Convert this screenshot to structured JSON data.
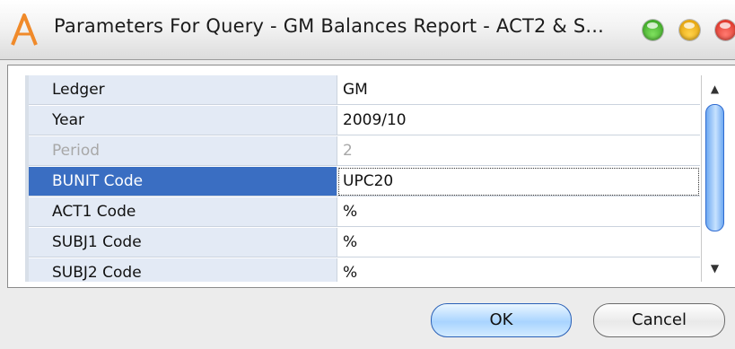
{
  "window": {
    "title": "Parameters For Query - GM Balances Report - ACT2 & S...",
    "controls": [
      "green-zoom",
      "yellow-minimize",
      "red-close"
    ]
  },
  "parameters": {
    "rows": [
      {
        "name": "Ledger",
        "value": "GM",
        "state": "normal"
      },
      {
        "name": "Year",
        "value": "2009/10",
        "state": "normal"
      },
      {
        "name": "Period",
        "value": "2",
        "state": "disabled"
      },
      {
        "name": "BUNIT Code",
        "value": "UPC20",
        "state": "selected"
      },
      {
        "name": "ACT1 Code",
        "value": "%",
        "state": "normal"
      },
      {
        "name": "SUBJ1 Code",
        "value": "%",
        "state": "normal"
      },
      {
        "name": "SUBJ2 Code",
        "value": "%",
        "state": "normal"
      }
    ]
  },
  "scroll": {
    "up": "▲",
    "down": "▼"
  },
  "buttons": {
    "ok": "OK",
    "cancel": "Cancel"
  },
  "colors": {
    "selection": "#3a6ec2",
    "name_column": "#e3eaf5",
    "accent": "#2f6bd0"
  }
}
